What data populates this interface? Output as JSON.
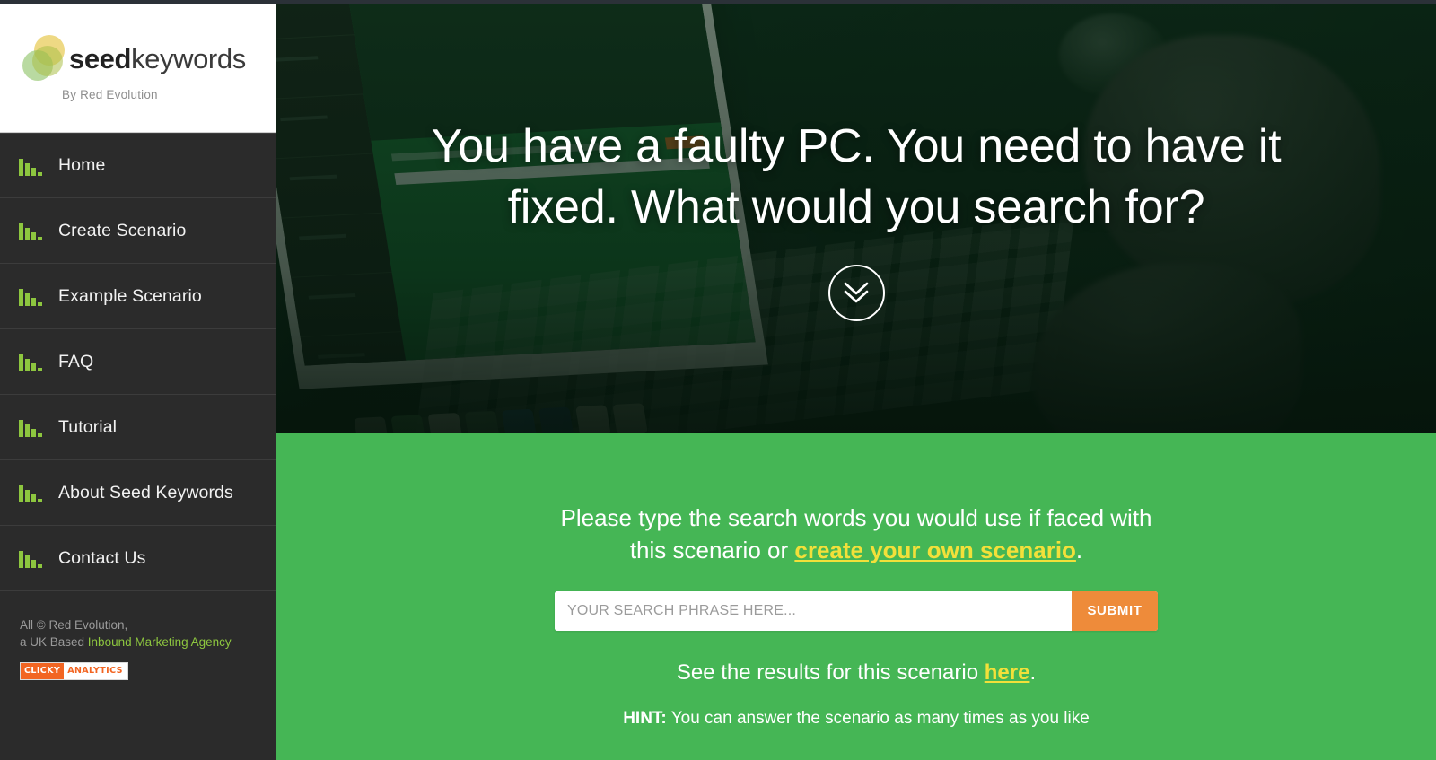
{
  "brand": {
    "name_bold": "seed",
    "name_light": "keywords",
    "tagline": "By Red Evolution",
    "logo_icon": "overlapping-circles-logo"
  },
  "sidebar": {
    "items": [
      {
        "label": "Home",
        "icon": "bar-chart-icon"
      },
      {
        "label": "Create Scenario",
        "icon": "bar-chart-icon"
      },
      {
        "label": "Example Scenario",
        "icon": "bar-chart-icon"
      },
      {
        "label": "FAQ",
        "icon": "bar-chart-icon"
      },
      {
        "label": "Tutorial",
        "icon": "bar-chart-icon"
      },
      {
        "label": "About Seed Keywords",
        "icon": "bar-chart-icon"
      },
      {
        "label": "Contact Us",
        "icon": "bar-chart-icon"
      }
    ],
    "footer": {
      "copyright": "All © Red Evolution,",
      "based_prefix": "a UK Based ",
      "agency_link": "Inbound Marketing Agency",
      "badge_left": "CLICKY",
      "badge_right": "ANALYTICS"
    }
  },
  "hero": {
    "headline": "You have a faulty PC. You need to have it fixed. What would you search for?",
    "scroll_icon": "chevron-double-down-icon",
    "background_image": "laptop-hands-typing-photo"
  },
  "form_section": {
    "lead_part1": "Please type the search words you would use if faced with this scenario or ",
    "lead_link": "create your own scenario",
    "lead_part2": ".",
    "search_placeholder": "YOUR SEARCH PHRASE HERE...",
    "search_value": "",
    "submit_label": "SUBMIT",
    "results_prefix": "See the results for this scenario ",
    "results_link": "here",
    "results_suffix": ".",
    "hint_label": "HINT:",
    "hint_text": " You can answer the scenario as many times as you like"
  },
  "colors": {
    "brand_green": "#45b655",
    "accent_yellow": "#f2e03a",
    "submit_orange": "#ee8b3a",
    "sidebar_dark": "#2b2b2b",
    "icon_green": "#8dc63f",
    "badge_orange": "#f26522"
  }
}
